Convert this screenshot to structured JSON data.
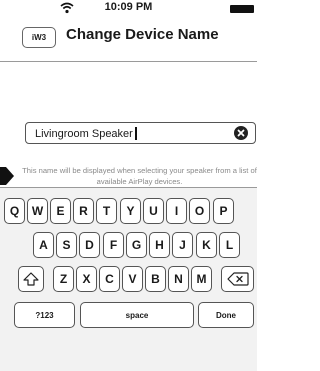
{
  "status_bar": {
    "time": "10:09 PM",
    "wifi_icon": "wifi-icon",
    "battery_icon": "battery-icon"
  },
  "nav": {
    "back_label": "iW3",
    "title": "Change Device Name"
  },
  "name_field": {
    "value": "Livingroom Speaker",
    "clear_icon": "clear-circle-x-icon"
  },
  "helper_text": "This name will be displayed when selecting your speaker from a list of available AirPlay devices.",
  "keyboard": {
    "row1": [
      "Q",
      "W",
      "E",
      "R",
      "T",
      "Y",
      "U",
      "I",
      "O",
      "P"
    ],
    "row2": [
      "A",
      "S",
      "D",
      "F",
      "G",
      "H",
      "J",
      "K",
      "L"
    ],
    "row3": [
      "Z",
      "X",
      "C",
      "V",
      "B",
      "N",
      "M"
    ],
    "shift_icon": "shift-arrow-icon",
    "backspace_icon": "backspace-icon",
    "numbers_label": "?123",
    "space_label": "space",
    "done_label": "Done"
  },
  "pointer_icon": "pointer-arrow-icon",
  "colors": {
    "border": "#555555",
    "divider": "#9a9a9a",
    "helper_text": "#8a8a8a"
  }
}
